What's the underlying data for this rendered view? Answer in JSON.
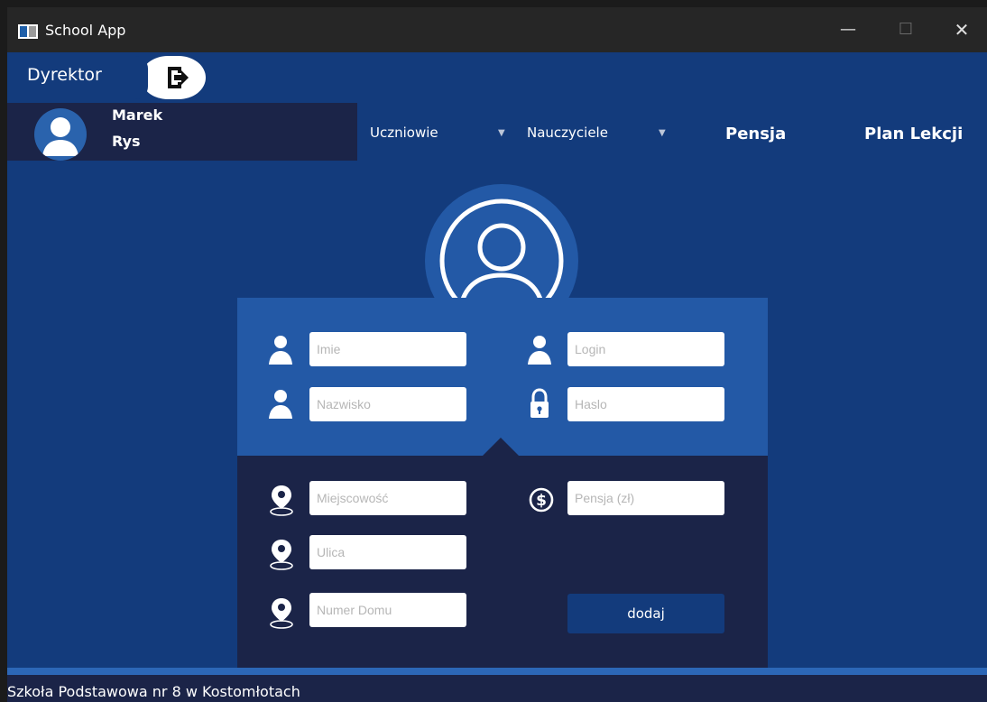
{
  "window": {
    "title": "School App",
    "controls": {
      "minimize": "—",
      "maximize": "☐",
      "close": "✕"
    }
  },
  "header": {
    "role": "Dyrektor",
    "user": {
      "first_name": "Marek",
      "last_name": "Rys"
    }
  },
  "nav": {
    "uczniowie": "Uczniowie",
    "nauczyciele": "Nauczyciele",
    "pensja": "Pensja",
    "plan": "Plan Lekcji"
  },
  "form": {
    "imie": {
      "placeholder": "Imie",
      "value": ""
    },
    "nazwisko": {
      "placeholder": "Nazwisko",
      "value": ""
    },
    "login": {
      "placeholder": "Login",
      "value": ""
    },
    "haslo": {
      "placeholder": "Haslo",
      "value": ""
    },
    "miejscowosc": {
      "placeholder": "Miejscowość",
      "value": ""
    },
    "ulica": {
      "placeholder": "Ulica",
      "value": ""
    },
    "numer_domu": {
      "placeholder": "Numer Domu",
      "value": ""
    },
    "pensja": {
      "placeholder": "Pensja (zł)",
      "value": ""
    },
    "submit_label": "dodaj"
  },
  "status": "Szkoła Podstawowa nr 8 w Kostomłotach",
  "colors": {
    "window_bg": "#133b7c",
    "panel_dark": "#1b2448",
    "card_light": "#2359a6",
    "titlebar": "#262626",
    "accent_stripe": "#2c67b7"
  }
}
